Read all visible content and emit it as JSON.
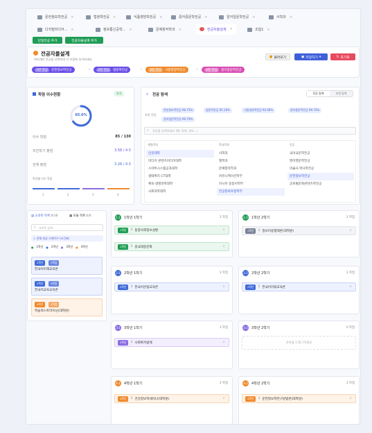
{
  "tabs": [
    {
      "label": "문헌정보학전공"
    },
    {
      "label": "법정학전공"
    },
    {
      "label": "식품영양학전공"
    },
    {
      "label": "중어중문학전공"
    },
    {
      "label": "일어일문학전공"
    },
    {
      "label": "사학과"
    },
    {
      "label": "디지털미디어..."
    },
    {
      "label": "정보통신공학..."
    },
    {
      "label": "문예창작학과"
    },
    {
      "label": "전공자율설계"
    },
    {
      "label": "조합1"
    }
  ],
  "tab_buttons": {
    "add_major": "단일전공 추가",
    "add_custom": "전공자율설계 추가"
  },
  "header": {
    "title": "전공자율설계",
    "subtitle": "여러개의 전공을 선택하여 각 조합에 추가하세요",
    "chips": [
      {
        "badge": "1번 전공",
        "label": "문헌정보학전공"
      },
      {
        "badge": "2번 전공",
        "label": "법정학전공"
      },
      {
        "badge": "3번 전공",
        "label": "식품영양학전공"
      },
      {
        "badge": "4번 전공",
        "label": "중어중문학전공"
      }
    ],
    "buttons": {
      "load": "불러오기",
      "save": "저장하기",
      "reset": "초기화"
    }
  },
  "credits": {
    "title": "학점 이수현황",
    "badge": "추가",
    "percent": "65.0%",
    "percent_value": 65,
    "rows": [
      {
        "label": "이수 학점",
        "value": "85 / 130"
      },
      {
        "label": "직전학기 평점",
        "value": "3.58 / 4.5"
      },
      {
        "label": "전체 평점",
        "value": "3.26 / 4.5"
      }
    ],
    "bar_title": "학년별 이수 학점",
    "bars": [
      {
        "label": "1",
        "color": "#3f6ad8"
      },
      {
        "label": "2",
        "color": "#3f6ad8"
      },
      {
        "label": "3",
        "color": "#8a6de0"
      },
      {
        "label": "4",
        "color": "#ef8a2c"
      }
    ]
  },
  "search": {
    "title": "전공 탐색",
    "toggle": [
      "전공 탐색",
      "추천 탐색"
    ],
    "rec_label": "추천 전공",
    "rec_tags": [
      "문헌정보학전공 96.73%",
      "법정학전공 95.16%",
      "식품영양학전공 92.46%",
      "중어중문학전공 90.74%",
      "일어일문학전공 90.74%"
    ],
    "placeholder": "전공을 검색하세요 (예: 경제, 정보...)",
    "col_headers": [
      "계열/학부",
      "학과/학부",
      "전공"
    ],
    "col1": [
      "인문대학",
      "미디어 콘텐츠미디어대학",
      "스마트시스템공과대학",
      "생태복지 CT대학",
      "체육·생명과학대학",
      "사회과학대학"
    ],
    "col2": [
      "사학과",
      "철학과",
      "문예창작학과",
      "커뮤니케이션학부",
      "아시아 중동어학부",
      "전공분야조정학부"
    ],
    "col3": [
      "국어국문학전공",
      "영어영문학전공",
      "미술사·역사학전공",
      "문헌정보학전공",
      "글로벌문화콘텐츠학전공"
    ]
  },
  "left": {
    "tab1": "교과목 목록",
    "count1": "8/38",
    "tab2": "모듈 목록",
    "count2": "6/8",
    "search_placeholder": "교과목 검색...",
    "notice": "전체 대상 기계이수 (조건표)",
    "legend": [
      "1학년",
      "2학년",
      "3학년",
      "4학년"
    ],
    "courses": [
      {
        "badge1": "2학년",
        "badge2": "3학점",
        "name": "한국어이해교육론"
      },
      {
        "badge1": "3학년",
        "badge2": "3학점",
        "name": "한국어교육교육론"
      },
      {
        "badge1": "4학년",
        "badge2": "3학점",
        "name": "학습력스트라이닝(대학원)"
      }
    ]
  },
  "semesters": [
    {
      "num": "1-1",
      "title": "1학년 1학기",
      "count": "3 학점",
      "courses": [
        {
          "badge": "1학년",
          "credit": "3",
          "name": "동양사회정보설명"
        },
        {
          "badge": "1학년",
          "credit": "3",
          "name": "중국대중문화"
        }
      ]
    },
    {
      "num": "1-2",
      "title": "1학년 2학기",
      "count": "3 학점",
      "courses": [
        {
          "badge": "1학년",
          "credit": "3",
          "name": "정보이용행태론(대학원)"
        }
      ]
    },
    {
      "num": "2-1",
      "title": "2학년 1학기",
      "count": "3 학점",
      "courses": [
        {
          "badge": "2학년",
          "credit": "3",
          "name": "한국어문법교육론"
        }
      ]
    },
    {
      "num": "2-2",
      "title": "2학년 2학기",
      "count": "3 학점",
      "courses": [
        {
          "badge": "2학년",
          "credit": "3",
          "name": "한국어어휘교육론"
        }
      ]
    },
    {
      "num": "3-1",
      "title": "3학년 1학기",
      "count": "3 학점",
      "courses": [
        {
          "badge": "3학년",
          "credit": "3",
          "name": "사회복지법제"
        }
      ]
    },
    {
      "num": "3-2",
      "title": "3학년 2학기",
      "count": "0 학점",
      "empty": "과목을 드래그하세요"
    },
    {
      "num": "4-1",
      "title": "4학년 1학기",
      "count": "3 학점",
      "courses": [
        {
          "badge": "4학년",
          "credit": "3",
          "name": "건강정보학세미나(대학원)"
        }
      ]
    },
    {
      "num": "4-2",
      "title": "4학년 2학기",
      "count": "3 학점",
      "courses": [
        {
          "badge": "4학년",
          "credit": "3",
          "name": "문헌정보학연구방법론(대학원)"
        }
      ]
    }
  ],
  "colors": {
    "accent": "#6a4de8",
    "save": "#3f5fd9",
    "reset": "#e84a5f",
    "load": "#f1f1f1",
    "green": "#1f9d55",
    "blue": "#3f6ad8",
    "orange": "#ef8a2c",
    "purple": "#8a6de0"
  }
}
